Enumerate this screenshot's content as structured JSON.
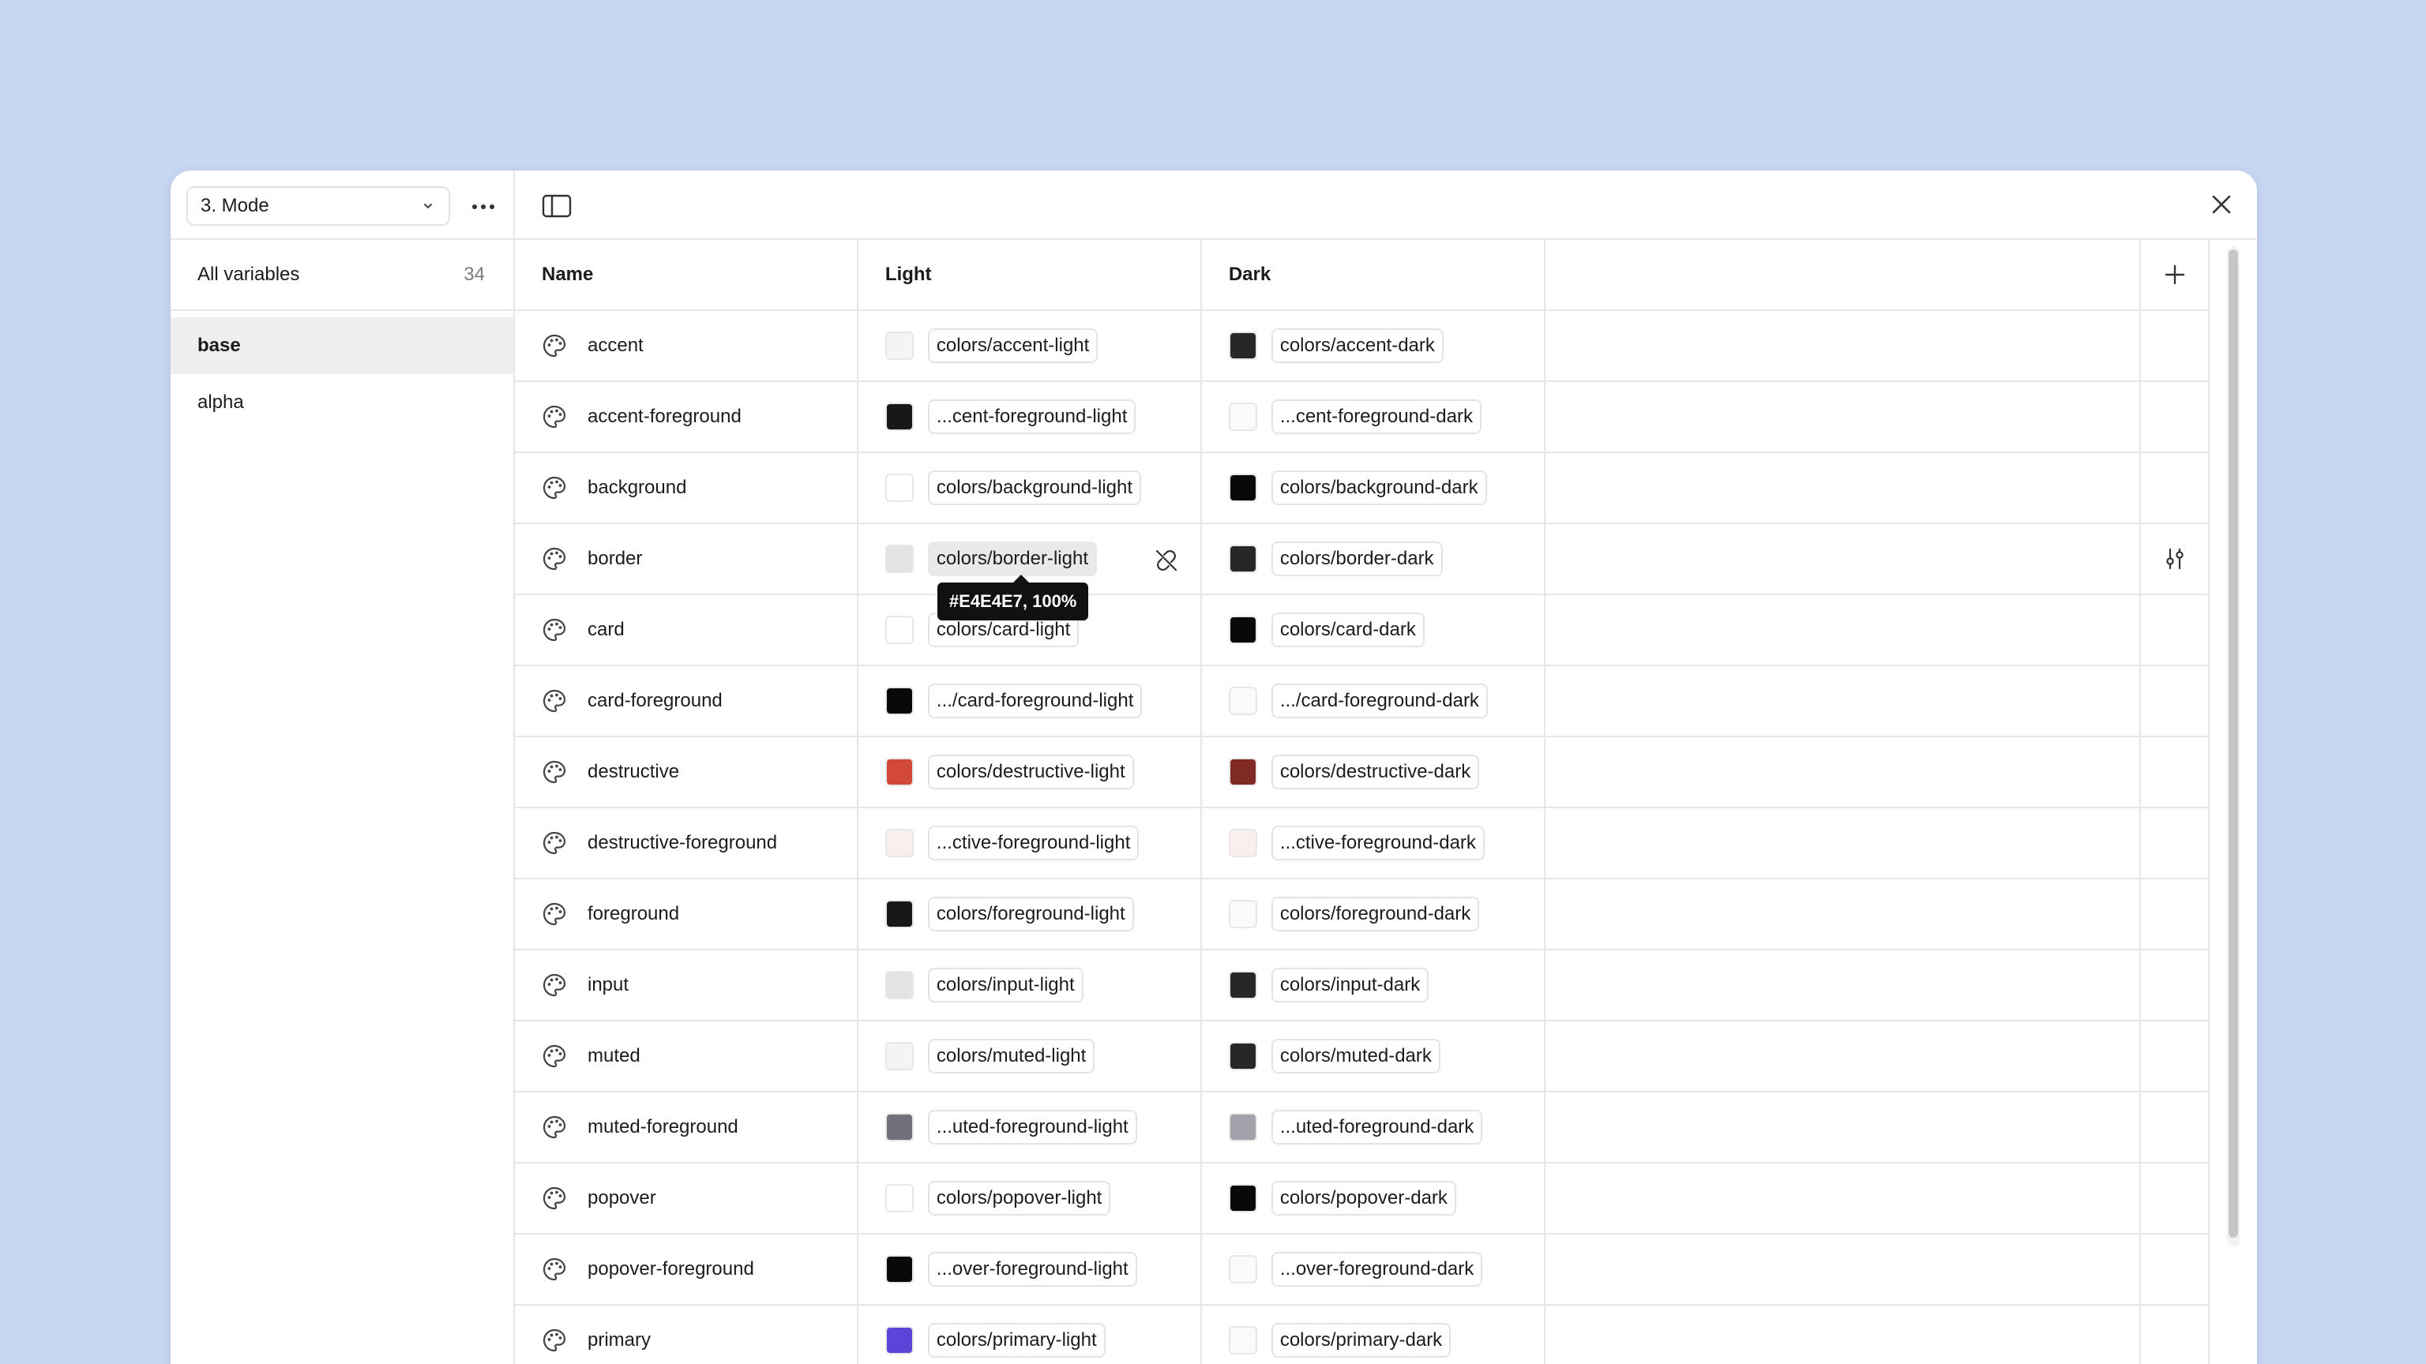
{
  "sidebar": {
    "mode_select": {
      "value": "3. Mode"
    },
    "all_variables": {
      "label": "All variables",
      "count": "34"
    },
    "collections": [
      {
        "label": "base",
        "active": true
      },
      {
        "label": "alpha",
        "active": false
      }
    ]
  },
  "table": {
    "columns": {
      "name": "Name",
      "light": "Light",
      "dark": "Dark"
    },
    "rows": [
      {
        "name": "accent",
        "light": {
          "label": "colors/accent-light",
          "color": "#f4f4f5"
        },
        "dark": {
          "label": "colors/accent-dark",
          "color": "#27272a"
        }
      },
      {
        "name": "accent-foreground",
        "light": {
          "label": "...cent-foreground-light",
          "color": "#18181b"
        },
        "dark": {
          "label": "...cent-foreground-dark",
          "color": "#fafafa"
        }
      },
      {
        "name": "background",
        "light": {
          "label": "colors/background-light",
          "color": "#ffffff"
        },
        "dark": {
          "label": "colors/background-dark",
          "color": "#09090b"
        }
      },
      {
        "name": "border",
        "light": {
          "label": "colors/border-light",
          "color": "#e4e4e7"
        },
        "dark": {
          "label": "colors/border-dark",
          "color": "#27272a"
        }
      },
      {
        "name": "card",
        "light": {
          "label": "colors/card-light",
          "color": "#ffffff"
        },
        "dark": {
          "label": "colors/card-dark",
          "color": "#09090b"
        }
      },
      {
        "name": "card-foreground",
        "light": {
          "label": ".../card-foreground-light",
          "color": "#09090b"
        },
        "dark": {
          "label": ".../card-foreground-dark",
          "color": "#fafafa"
        }
      },
      {
        "name": "destructive",
        "light": {
          "label": "colors/destructive-light",
          "color": "#d2493a"
        },
        "dark": {
          "label": "colors/destructive-dark",
          "color": "#7f2a22"
        }
      },
      {
        "name": "destructive-foreground",
        "light": {
          "label": "...ctive-foreground-light",
          "color": "#fbeeee"
        },
        "dark": {
          "label": "...ctive-foreground-dark",
          "color": "#fbeeee"
        }
      },
      {
        "name": "foreground",
        "light": {
          "label": "colors/foreground-light",
          "color": "#18181b"
        },
        "dark": {
          "label": "colors/foreground-dark",
          "color": "#fafafa"
        }
      },
      {
        "name": "input",
        "light": {
          "label": "colors/input-light",
          "color": "#e4e4e7"
        },
        "dark": {
          "label": "colors/input-dark",
          "color": "#27272a"
        }
      },
      {
        "name": "muted",
        "light": {
          "label": "colors/muted-light",
          "color": "#f4f4f5"
        },
        "dark": {
          "label": "colors/muted-dark",
          "color": "#27272a"
        }
      },
      {
        "name": "muted-foreground",
        "light": {
          "label": "...uted-foreground-light",
          "color": "#71717a"
        },
        "dark": {
          "label": "...uted-foreground-dark",
          "color": "#a1a1aa"
        }
      },
      {
        "name": "popover",
        "light": {
          "label": "colors/popover-light",
          "color": "#ffffff"
        },
        "dark": {
          "label": "colors/popover-dark",
          "color": "#09090b"
        }
      },
      {
        "name": "popover-foreground",
        "light": {
          "label": "...over-foreground-light",
          "color": "#09090b"
        },
        "dark": {
          "label": "...over-foreground-dark",
          "color": "#fafafa"
        }
      },
      {
        "name": "primary",
        "light": {
          "label": "colors/primary-light",
          "color": "#5b45d9"
        },
        "dark": {
          "label": "colors/primary-dark",
          "color": "#fafafa"
        }
      }
    ]
  },
  "tooltip": {
    "text": "#E4E4E7, 100%"
  },
  "icons": {
    "variable_type": "palette-icon",
    "panel_toggle": "sidebar-panel-icon",
    "close": "close-icon",
    "add_mode": "plus-icon",
    "detach": "detach-alias-icon",
    "edit_variable": "adjust-icon",
    "more": "more-horizontal-icon",
    "chevron": "chevron-down-icon"
  }
}
